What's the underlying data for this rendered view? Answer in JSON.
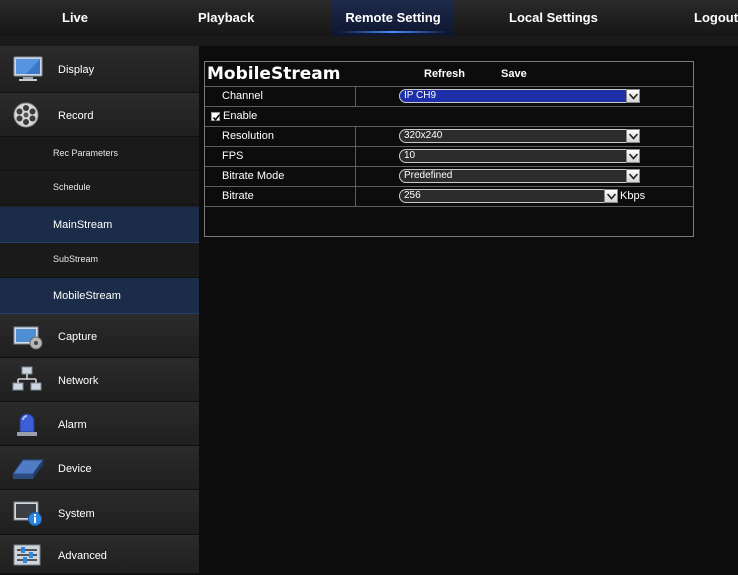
{
  "nav": {
    "tabs": [
      {
        "label": "Live"
      },
      {
        "label": "Playback"
      },
      {
        "label": "Remote Setting"
      },
      {
        "label": "Local Settings"
      },
      {
        "label": "Logout"
      }
    ],
    "active": "Remote Setting"
  },
  "sidebar": {
    "items": [
      {
        "label": "Display",
        "icon": "monitor-icon"
      },
      {
        "label": "Record",
        "icon": "film-reel-icon"
      },
      {
        "label": "Capture",
        "icon": "camera-gear-icon"
      },
      {
        "label": "Network",
        "icon": "network-icon"
      },
      {
        "label": "Alarm",
        "icon": "alarm-light-icon"
      },
      {
        "label": "Device",
        "icon": "hard-drive-icon"
      },
      {
        "label": "System",
        "icon": "system-info-icon"
      },
      {
        "label": "Advanced",
        "icon": "advanced-settings-icon"
      }
    ],
    "record_sub": [
      {
        "label": "Rec Parameters"
      },
      {
        "label": "Schedule"
      },
      {
        "label": "MainStream"
      },
      {
        "label": "SubStream"
      },
      {
        "label": "MobileStream"
      }
    ],
    "selected_sub": "MobileStream"
  },
  "panel": {
    "title": "MobileStream",
    "refresh_label": "Refresh",
    "save_label": "Save",
    "channel": {
      "label": "Channel",
      "value": "IP CH9"
    },
    "enable": {
      "label": "Enable",
      "checked": true
    },
    "resolution": {
      "label": "Resolution",
      "value": "320x240"
    },
    "fps": {
      "label": "FPS",
      "value": "10"
    },
    "bitrate_mode": {
      "label": "Bitrate Mode",
      "value": "Predefined"
    },
    "bitrate": {
      "label": "Bitrate",
      "value": "256",
      "unit": "Kbps"
    }
  },
  "colors": {
    "background": "#0c0c0c",
    "sidebar": "#1d1d1d",
    "selected": "#1a2c48",
    "highlight_select": "#1c2fa8"
  }
}
